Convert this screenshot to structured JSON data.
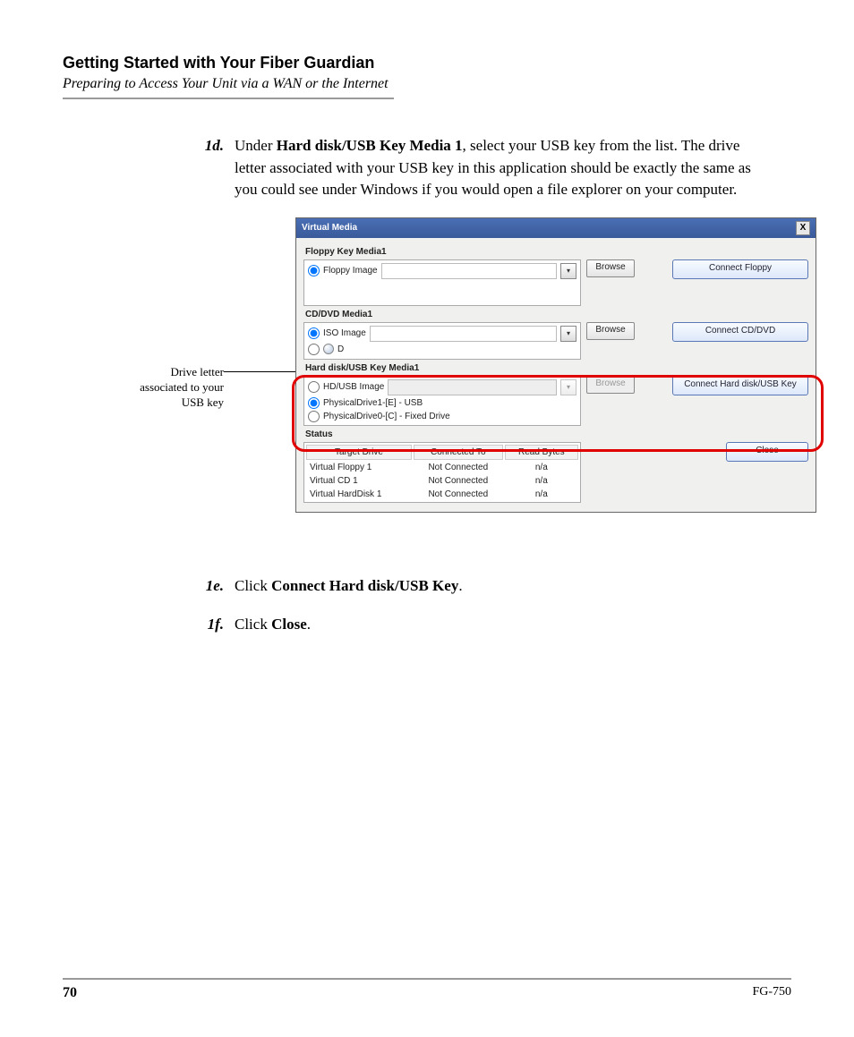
{
  "header": {
    "title": "Getting Started with Your Fiber Guardian",
    "subtitle": "Preparing to Access Your Unit via a WAN or the Internet"
  },
  "steps": {
    "d_num": "1d.",
    "d_pre": "Under ",
    "d_bold": "Hard disk/USB Key Media 1",
    "d_post": ", select your USB key from the list. The drive letter associated with your USB key in this application should be exactly the same as you could see under Windows if you would open a file explorer on your computer.",
    "e_num": "1e.",
    "e_pre": "Click ",
    "e_bold": "Connect Hard disk/USB Key",
    "e_post": ".",
    "f_num": "1f.",
    "f_pre": "Click ",
    "f_bold": "Close",
    "f_post": "."
  },
  "callout": "Drive letter associated to your USB key",
  "vm": {
    "title": "Virtual Media",
    "close_x": "X",
    "floppy": {
      "group": "Floppy Key Media1",
      "radio": "Floppy Image",
      "browse": "Browse",
      "connect": "Connect Floppy"
    },
    "cd": {
      "group": "CD/DVD Media1",
      "radio": "ISO Image",
      "drive": "D",
      "browse": "Browse",
      "connect": "Connect CD/DVD"
    },
    "hd": {
      "group": "Hard disk/USB Key Media1",
      "radio": "HD/USB Image",
      "opt1": "PhysicalDrive1-[E] - USB",
      "opt2": "PhysicalDrive0-[C] - Fixed Drive",
      "browse": "Browse",
      "connect": "Connect Hard disk/USB Key"
    },
    "status": {
      "group": "Status",
      "h_target": "Target Drive",
      "h_conn": "Connected To",
      "h_read": "Read Bytes",
      "rows": [
        "Virtual Floppy 1",
        "Virtual CD 1",
        "Virtual HardDisk 1"
      ],
      "not_conn": "Not Connected",
      "na": "n/a",
      "close": "Close"
    }
  },
  "footer": {
    "page": "70",
    "doc": "FG-750"
  }
}
